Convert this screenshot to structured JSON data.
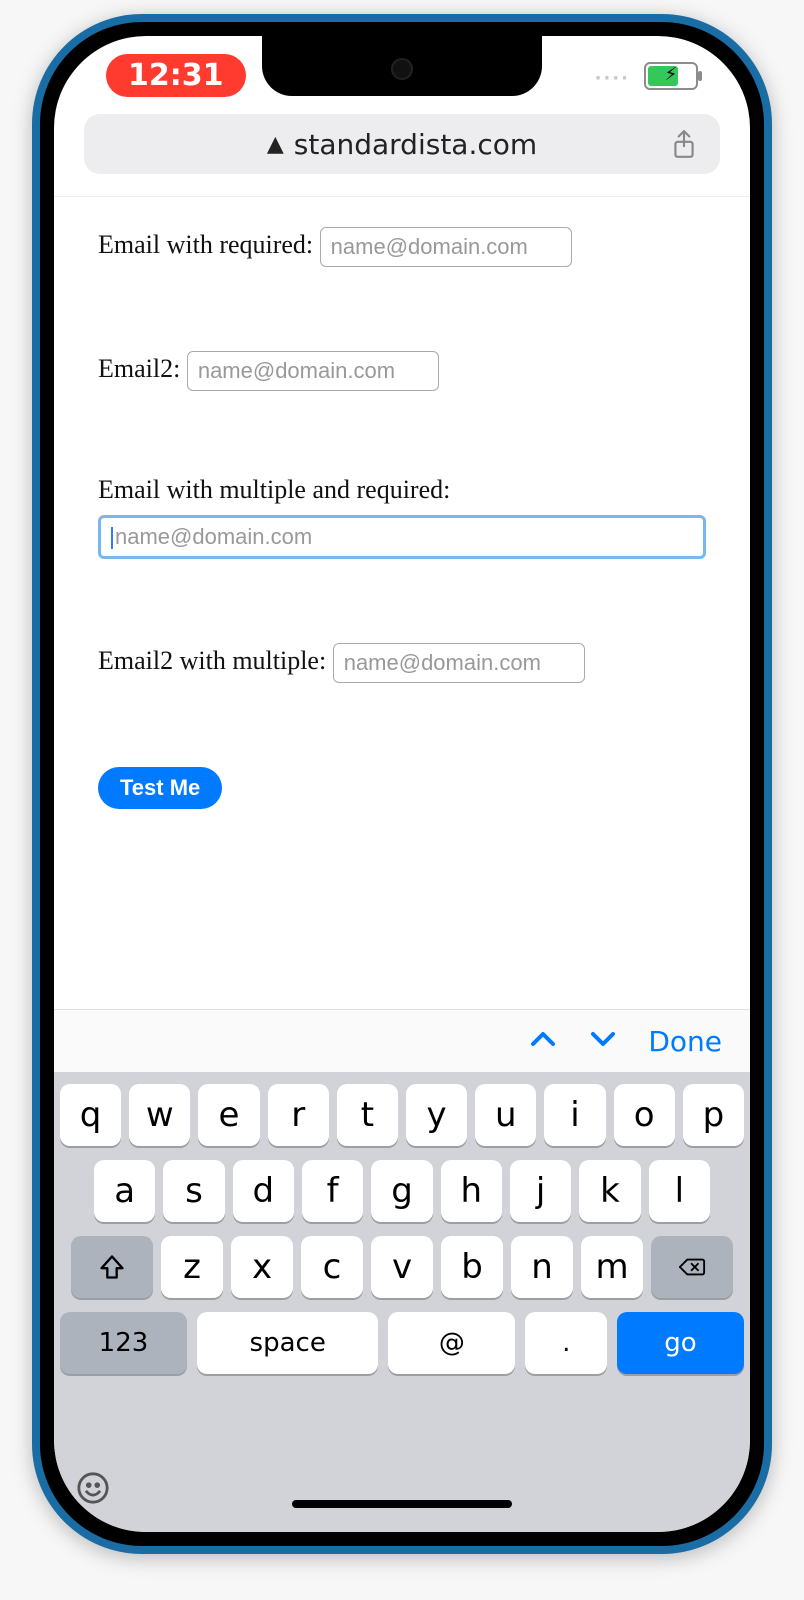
{
  "status": {
    "time": "12:31"
  },
  "urlbar": {
    "domain": "standardista.com"
  },
  "form": {
    "fields": [
      {
        "label": "Email with required:",
        "placeholder": "name@domain.com",
        "value": ""
      },
      {
        "label": "Email2:",
        "placeholder": "name@domain.com",
        "value": ""
      },
      {
        "label": "Email with multiple and required:",
        "placeholder": "name@domain.com",
        "value": "",
        "focused": true
      },
      {
        "label": "Email2 with multiple:",
        "placeholder": "name@domain.com",
        "value": ""
      }
    ],
    "submit_label": "Test Me"
  },
  "accessory": {
    "done": "Done"
  },
  "keyboard": {
    "row1": [
      "q",
      "w",
      "e",
      "r",
      "t",
      "y",
      "u",
      "i",
      "o",
      "p"
    ],
    "row2": [
      "a",
      "s",
      "d",
      "f",
      "g",
      "h",
      "j",
      "k",
      "l"
    ],
    "row3": [
      "z",
      "x",
      "c",
      "v",
      "b",
      "n",
      "m"
    ],
    "numbers": "123",
    "space": "space",
    "at": "@",
    "dot": ".",
    "go": "go"
  }
}
